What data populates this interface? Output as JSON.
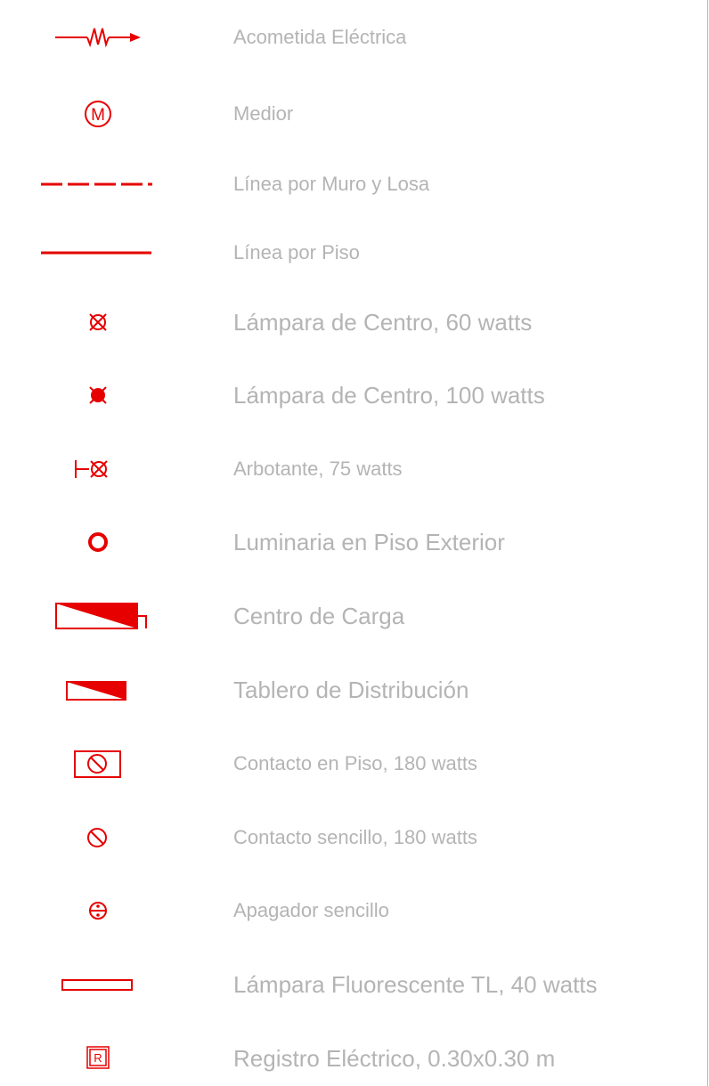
{
  "colors": {
    "symbol": "#e60000",
    "label": "#b4b4b4"
  },
  "items": [
    {
      "icon": "electric-service-icon",
      "label": "Acometida Eléctrica"
    },
    {
      "icon": "meter-icon",
      "label": "Medior",
      "glyph": "M"
    },
    {
      "icon": "dashed-line-icon",
      "label": "Línea por Muro y Losa"
    },
    {
      "icon": "solid-line-icon",
      "label": "Línea por Piso"
    },
    {
      "icon": "ceiling-lamp-60w-icon",
      "label": "Lámpara de Centro, 60 watts"
    },
    {
      "icon": "ceiling-lamp-100w-icon",
      "label": "Lámpara de Centro, 100 watts"
    },
    {
      "icon": "wall-lamp-icon",
      "label": "Arbotante, 75 watts"
    },
    {
      "icon": "exterior-floor-light-icon",
      "label": "Luminaria en Piso Exterior"
    },
    {
      "icon": "load-center-icon",
      "label": "Centro de Carga"
    },
    {
      "icon": "distribution-board-icon",
      "label": "Tablero de Distribución"
    },
    {
      "icon": "floor-outlet-icon",
      "label": "Contacto en Piso, 180 watts"
    },
    {
      "icon": "single-outlet-icon",
      "label": "Contacto sencillo, 180 watts"
    },
    {
      "icon": "single-switch-icon",
      "label": "Apagador sencillo"
    },
    {
      "icon": "fluorescent-lamp-icon",
      "label": "Lámpara Fluorescente TL, 40 watts"
    },
    {
      "icon": "junction-box-icon",
      "label": "Registro Eléctrico, 0.30x0.30 m",
      "glyph": "R"
    }
  ]
}
